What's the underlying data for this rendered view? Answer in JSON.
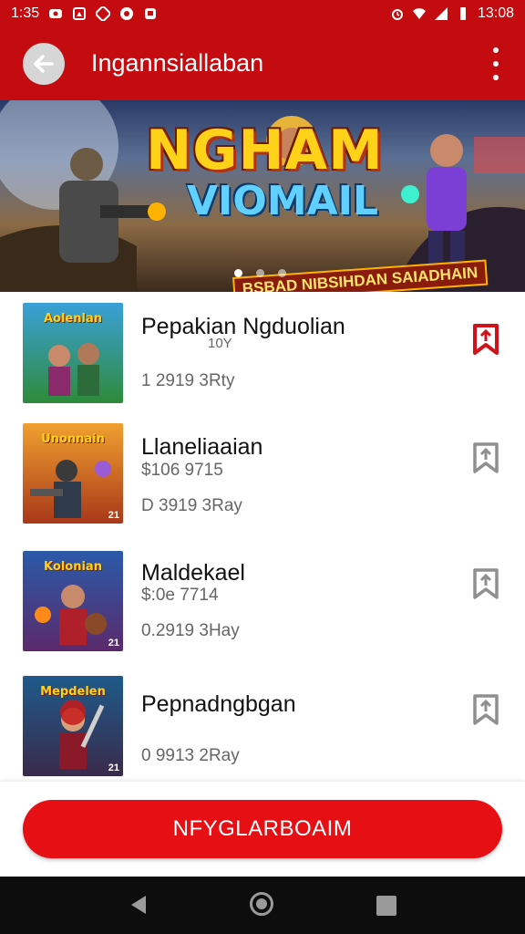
{
  "status_bar": {
    "time": "1:35",
    "clock": "13:08"
  },
  "app_bar": {
    "title": "Ingannsiallaban"
  },
  "banner": {
    "title_line1": "NGHAM",
    "title_line2": "VIOMAIL",
    "subtitle": "BSBAD NIBSIHDAN SAIADHAIN",
    "pages": 3,
    "active_page": 1
  },
  "items": [
    {
      "thumb_label": "Aolenlan",
      "title": "Pepakian Ngduolian",
      "subtitle": "10Y",
      "meta": "1 2919  3Rty",
      "bookmarked": true,
      "badge": ""
    },
    {
      "thumb_label": "Unonnain",
      "title": "Llaneliaaian",
      "subtitle": "$106 9715",
      "meta": "D 3919  3Ray",
      "bookmarked": false,
      "badge": "21"
    },
    {
      "thumb_label": "Kolonian",
      "title": "Maldekael",
      "subtitle": "$:0e 7714",
      "meta": "0.2919  3Hay",
      "bookmarked": false,
      "badge": "21"
    },
    {
      "thumb_label": "Mepdelen",
      "title": "Pepnadngbgan",
      "subtitle": "",
      "meta": "0 9913  2Ray",
      "bookmarked": false,
      "badge": "21"
    }
  ],
  "cta": {
    "label": "NFYGLARBOAIM"
  },
  "colors": {
    "brand_red": "#c40b10",
    "cta_red": "#e60f14"
  }
}
